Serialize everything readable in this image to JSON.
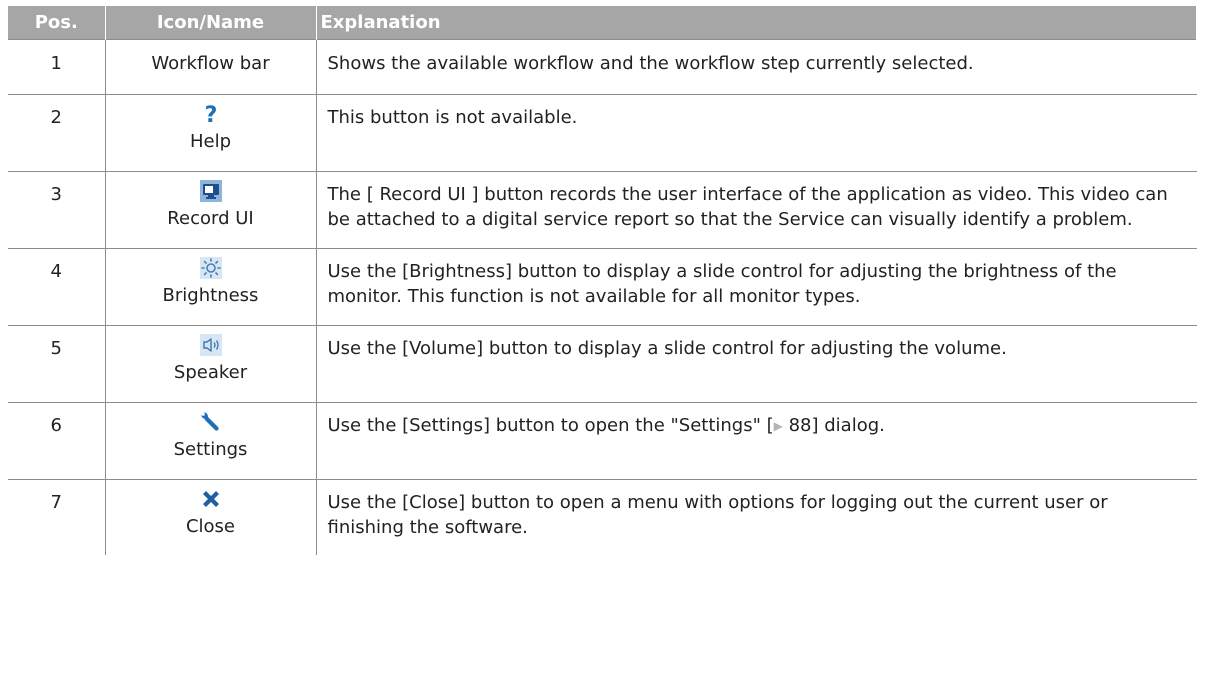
{
  "headers": {
    "pos": "Pos.",
    "icon": "Icon/Name",
    "explanation": "Explanation"
  },
  "rows": [
    {
      "pos": "1",
      "name": "Workflow bar",
      "icon": "",
      "explanation": "Shows the available workflow and the workflow step currently selected."
    },
    {
      "pos": "2",
      "name": "Help",
      "icon": "help-icon",
      "explanation": "This button is not available."
    },
    {
      "pos": "3",
      "name": "Record UI",
      "icon": "record-ui-icon",
      "explanation": "The [ Record UI ] button records the user interface of the application as video. This video can be attached to a digital service report so that the Service can visually identify a problem."
    },
    {
      "pos": "4",
      "name": "Brightness",
      "icon": "brightness-icon",
      "explanation": "Use the [Brightness] button to display a slide control for adjusting the brightness of the monitor. This function is not available for all monitor types."
    },
    {
      "pos": "5",
      "name": "Speaker",
      "icon": "speaker-icon",
      "explanation": "Use the [Volume] button to display a slide control for adjusting the volume."
    },
    {
      "pos": "6",
      "name": "Settings",
      "icon": "settings-wrench-icon",
      "explanation_before": "Use the [Settings] button to open the \"Settings\" [",
      "link_arrow": "▶",
      "explanation_link": " 88",
      "explanation_after": "] dialog."
    },
    {
      "pos": "7",
      "name": "Close",
      "icon": "close-x-icon",
      "explanation": "Use the [Close] button to open a menu with options for logging out the current user or finishing the software."
    }
  ],
  "colors": {
    "header_bg": "#a6a6a6",
    "icon_blue": "#1f6fb7",
    "border": "#8c8c8c"
  }
}
